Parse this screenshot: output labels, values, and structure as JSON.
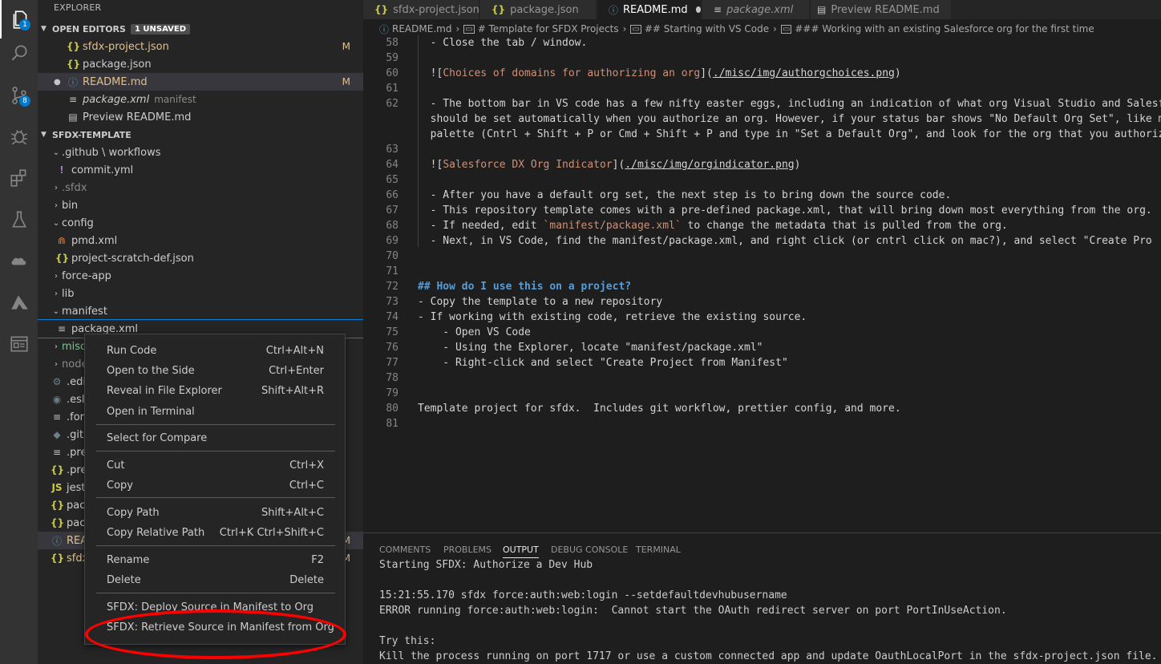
{
  "activity_bar": {
    "items": [
      {
        "name": "files-icon",
        "badge": "1"
      },
      {
        "name": "search-icon"
      },
      {
        "name": "source-control-icon",
        "badge": "8"
      },
      {
        "name": "debug-icon"
      },
      {
        "name": "extensions-icon"
      },
      {
        "name": "testing-icon"
      },
      {
        "name": "salesforce-icon"
      },
      {
        "name": "azure-icon"
      },
      {
        "name": "preview-icon"
      }
    ]
  },
  "sidebar": {
    "title": "EXPLORER",
    "open_editors": {
      "label": "OPEN EDITORS",
      "badge": "1 UNSAVED",
      "items": [
        {
          "label": "sfdx-project.json",
          "git": "M"
        },
        {
          "label": "package.json"
        },
        {
          "label": "README.md",
          "git": "M"
        },
        {
          "label": "package.xml",
          "desc": "manifest"
        },
        {
          "label": "Preview README.md"
        }
      ]
    },
    "project": {
      "label": "SFDX-TEMPLATE",
      "items": [
        {
          "label": ".github \\ workflows"
        },
        {
          "label": "commit.yml"
        },
        {
          "label": ".sfdx"
        },
        {
          "label": "bin"
        },
        {
          "label": "config"
        },
        {
          "label": "pmd.xml"
        },
        {
          "label": "project-scratch-def.json"
        },
        {
          "label": "force-app"
        },
        {
          "label": "lib"
        },
        {
          "label": "manifest"
        },
        {
          "label": "package.xml"
        },
        {
          "label": "misc"
        },
        {
          "label": "node"
        },
        {
          "label": ".edit"
        },
        {
          "label": ".eslin"
        },
        {
          "label": ".forc"
        },
        {
          "label": ".gitig"
        },
        {
          "label": ".pret"
        },
        {
          "label": ".pret"
        },
        {
          "label": "jest.c"
        },
        {
          "label": "pack"
        },
        {
          "label": "pack"
        },
        {
          "label": "READ",
          "git": "M"
        },
        {
          "label": "sfdx",
          "git": "M"
        }
      ]
    }
  },
  "tabs": [
    {
      "label": "sfdx-project.json"
    },
    {
      "label": "package.json"
    },
    {
      "label": "README.md"
    },
    {
      "label": "package.xml"
    },
    {
      "label": "Preview README.md"
    }
  ],
  "breadcrumb": {
    "file": "README.md",
    "h1": "# Template for SFDX Projects",
    "h2": "## Starting with VS Code",
    "h3": "### Working with an existing Salesforce org for the first time"
  },
  "editor": {
    "line_numbers": [
      "58",
      "59",
      "60",
      "61",
      "62",
      "63",
      "64",
      "65",
      "66",
      "67",
      "68",
      "69",
      "70",
      "71",
      "72",
      "73",
      "74",
      "75",
      "76",
      "77",
      "78",
      "79",
      "80",
      "81"
    ],
    "lines": {
      "l58": "  - Close the tab / window.",
      "l60a": "  ![",
      "l60b": "Choices of domains for authorizing an org",
      "l60c": "](",
      "l60d": "./misc/img/authorgchoices.png",
      "l60e": ")",
      "l62a": "  - The bottom bar in VS code has a few nifty easter eggs, including an indication of what org Visual Studio and Salesforce",
      "l62b": "  should be set automatically when you authorize an org. However, if your status bar shows \"No Default Org Set\", like mine",
      "l62c": "  palette (Cntrl + Shift + P or Cmd + Shift + P and type in \"Set a Default Org\", and look for the org that you authorized",
      "l64a": "  ![",
      "l64b": "Salesforce DX Org Indicator",
      "l64c": "](",
      "l64d": "./misc/img/orgindicator.png",
      "l64e": ")",
      "l66": "  - After you have a default org set, the next step is to bring down the source code.",
      "l67": "  - This repository template comes with a pre-defined package.xml, that will bring down most everything from the org.",
      "l68a": "  - If needed, edit ",
      "l68b": "`manifest/package.xml`",
      "l68c": " to change the metadata that is pulled from the org.",
      "l69": "  - Next, in VS Code, find the manifest/package.xml, and right click (or cntrl click on mac?), and select \"Create Pro",
      "l72": "## How do I use this on a project?",
      "l73": "- Copy the template to a new repository",
      "l74": "- If working with existing code, retrieve the existing source.",
      "l75": "    - Open VS Code",
      "l76": "    - Using the Explorer, locate \"manifest/package.xml\"",
      "l77": "    - Right-click and select \"Create Project from Manifest\"",
      "l80": "Template project for sfdx.  Includes git workflow, prettier config, and more."
    }
  },
  "panel": {
    "tabs": [
      "COMMENTS",
      "PROBLEMS",
      "OUTPUT",
      "DEBUG CONSOLE",
      "TERMINAL"
    ],
    "output": [
      "Starting SFDX: Authorize a Dev Hub",
      "15:21:55.170 sfdx force:auth:web:login --setdefaultdevhubusername",
      "ERROR running force:auth:web:login:  Cannot start the OAuth redirect server on port PortInUseAction.",
      "Try this:",
      "Kill the process running on port 1717 or use a custom connected app and update OauthLocalPort in the sfdx-project.json file."
    ]
  },
  "context_menu": {
    "items": [
      {
        "label": "Run Code",
        "shortcut": "Ctrl+Alt+N"
      },
      {
        "label": "Open to the Side",
        "shortcut": "Ctrl+Enter"
      },
      {
        "label": "Reveal in File Explorer",
        "shortcut": "Shift+Alt+R"
      },
      {
        "label": "Open in Terminal",
        "shortcut": ""
      },
      {
        "label": "Select for Compare",
        "shortcut": ""
      },
      {
        "label": "Cut",
        "shortcut": "Ctrl+X"
      },
      {
        "label": "Copy",
        "shortcut": "Ctrl+C"
      },
      {
        "label": "Copy Path",
        "shortcut": "Shift+Alt+C"
      },
      {
        "label": "Copy Relative Path",
        "shortcut": "Ctrl+K Ctrl+Shift+C"
      },
      {
        "label": "Rename",
        "shortcut": "F2"
      },
      {
        "label": "Delete",
        "shortcut": "Delete"
      },
      {
        "label": "SFDX: Deploy Source in Manifest to Org",
        "shortcut": ""
      },
      {
        "label": "SFDX: Retrieve Source in Manifest from Org",
        "shortcut": ""
      }
    ],
    "highlight_color": "#ff0000"
  }
}
